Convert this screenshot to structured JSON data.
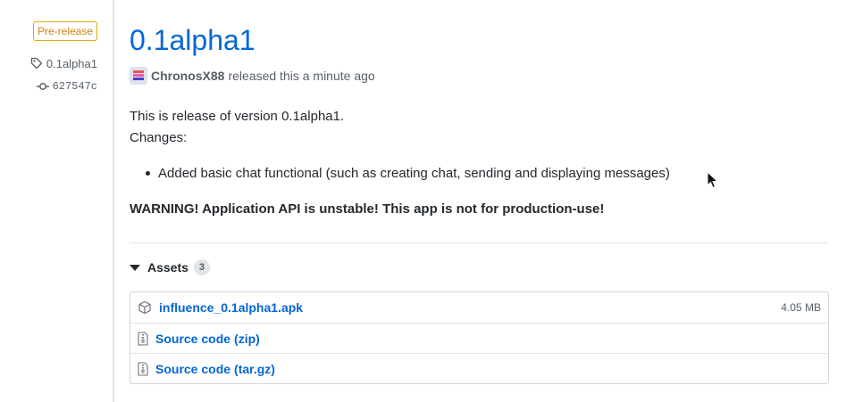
{
  "sidebar": {
    "prerelease_label": "Pre-release",
    "tag": "0.1alpha1",
    "commit": "627547c"
  },
  "release": {
    "title": "0.1alpha1",
    "author": "ChronosX88",
    "released_text": "released this a minute ago",
    "body_line1": "This is release of version 0.1alpha1.",
    "body_line2": "Changes:",
    "changes": [
      "Added basic chat functional (such as creating chat, sending and displaying messages)"
    ],
    "warning": "WARNING! Application API is unstable! This app is not for production-use!"
  },
  "assets": {
    "label": "Assets",
    "count": "3",
    "items": [
      {
        "name": "influence_0.1alpha1.apk",
        "suffix": "",
        "size": "4.05 MB",
        "icon": "package-icon"
      },
      {
        "name": "Source code",
        "suffix": "(zip)",
        "size": "",
        "icon": "file-zip-icon"
      },
      {
        "name": "Source code",
        "suffix": "(tar.gz)",
        "size": "",
        "icon": "file-zip-icon"
      }
    ]
  },
  "colors": {
    "link": "#0366d6",
    "prerelease": "#d1840f",
    "text": "#24292e",
    "muted": "#586069"
  }
}
